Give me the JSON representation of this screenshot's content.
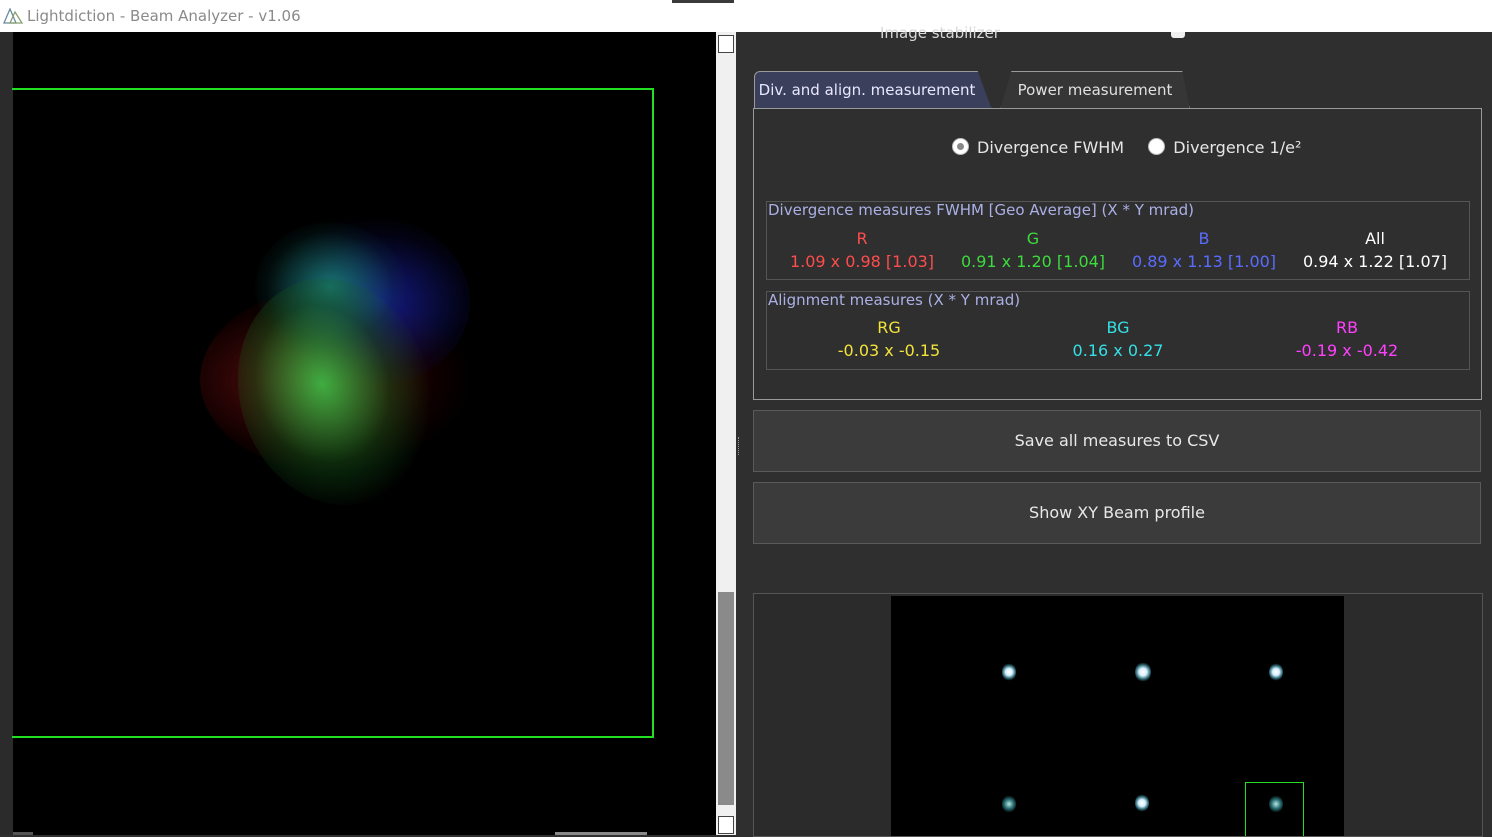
{
  "window": {
    "title": "Lightdiction - Beam Analyzer - v1.06",
    "logo_icon": "prism-icon"
  },
  "viewer": {
    "roi_color": "#21e021",
    "beam_colors": [
      "#c01818",
      "#1e9a30",
      "#2030c8"
    ]
  },
  "settings": {
    "image_stabilizer_label": "Image stabilizer"
  },
  "tabs": [
    {
      "label": "Div. and align. measurement",
      "active": true
    },
    {
      "label": "Power measurement",
      "active": false
    }
  ],
  "divergence_mode": {
    "options": [
      "Divergence FWHM",
      "Divergence 1/e²"
    ],
    "selected": "Divergence FWHM"
  },
  "divergence": {
    "title": "Divergence measures FWHM [Geo Average] (X * Y mrad)",
    "columns": [
      {
        "label": "R",
        "value": "1.09 x 0.98 [1.03]",
        "color": "#ff4c4c"
      },
      {
        "label": "G",
        "value": "0.91 x 1.20 [1.04]",
        "color": "#3ddc3d"
      },
      {
        "label": "B",
        "value": "0.89 x 1.13 [1.00]",
        "color": "#5a6cff"
      },
      {
        "label": "All",
        "value": "0.94 x 1.22 [1.07]",
        "color": "#ffffff"
      }
    ]
  },
  "alignment": {
    "title": "Alignment measures (X * Y mrad)",
    "columns": [
      {
        "label": "RG",
        "value": "-0.03 x -0.15",
        "color": "#f2e33a"
      },
      {
        "label": "BG",
        "value": "0.16 x 0.27",
        "color": "#34e0e6"
      },
      {
        "label": "RB",
        "value": "-0.19 x -0.42",
        "color": "#ff40ff"
      }
    ]
  },
  "buttons": {
    "save_csv": "Save all measures to CSV",
    "show_profile": "Show XY Beam profile"
  }
}
